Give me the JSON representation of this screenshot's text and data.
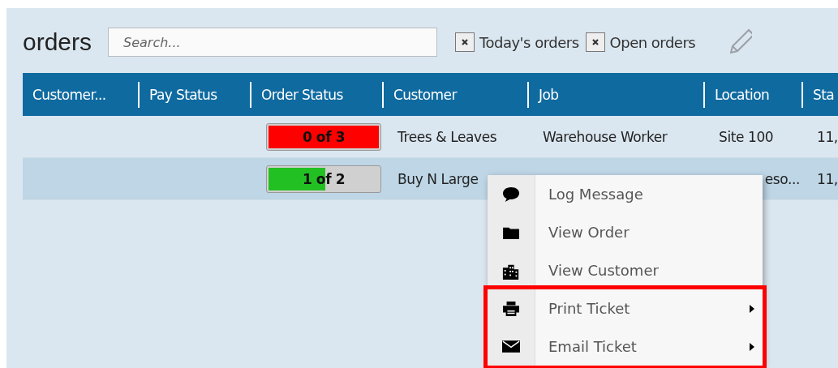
{
  "title": "orders",
  "search": {
    "placeholder": "Search..."
  },
  "filters": [
    {
      "label": "Today's orders",
      "checked": true
    },
    {
      "label": "Open orders",
      "checked": true
    }
  ],
  "table": {
    "columns": [
      "Customer...",
      "Pay Status",
      "Order Status",
      "Customer",
      "Job",
      "Location",
      "Sta"
    ],
    "rows": [
      {
        "selected": false,
        "order_status": {
          "text": "0 of 3",
          "level": 1,
          "color": "#ff0000"
        },
        "customer": "Trees & Leaves",
        "job": "Warehouse Worker",
        "location": {
          "text": "Site 100",
          "covered": false
        },
        "column_7": "11,"
      },
      {
        "selected": true,
        "order_status": {
          "text": "1 of 2",
          "level": 0.5,
          "color": "#22c022"
        },
        "customer": "Buy N Large",
        "location": {
          "text": "eso...",
          "covered": true
        },
        "column_7": "11,"
      }
    ]
  },
  "context_menu": {
    "groups": [
      {
        "highlighted": false,
        "items": [
          {
            "label": "Log Message",
            "submenu": false
          },
          {
            "label": "View Order",
            "submenu": false
          },
          {
            "label": "View Customer",
            "submenu": false
          }
        ]
      },
      {
        "highlighted": true,
        "items": [
          {
            "label": "Print Ticket",
            "submenu": true
          },
          {
            "label": "Email Ticket",
            "submenu": true
          }
        ]
      }
    ]
  }
}
